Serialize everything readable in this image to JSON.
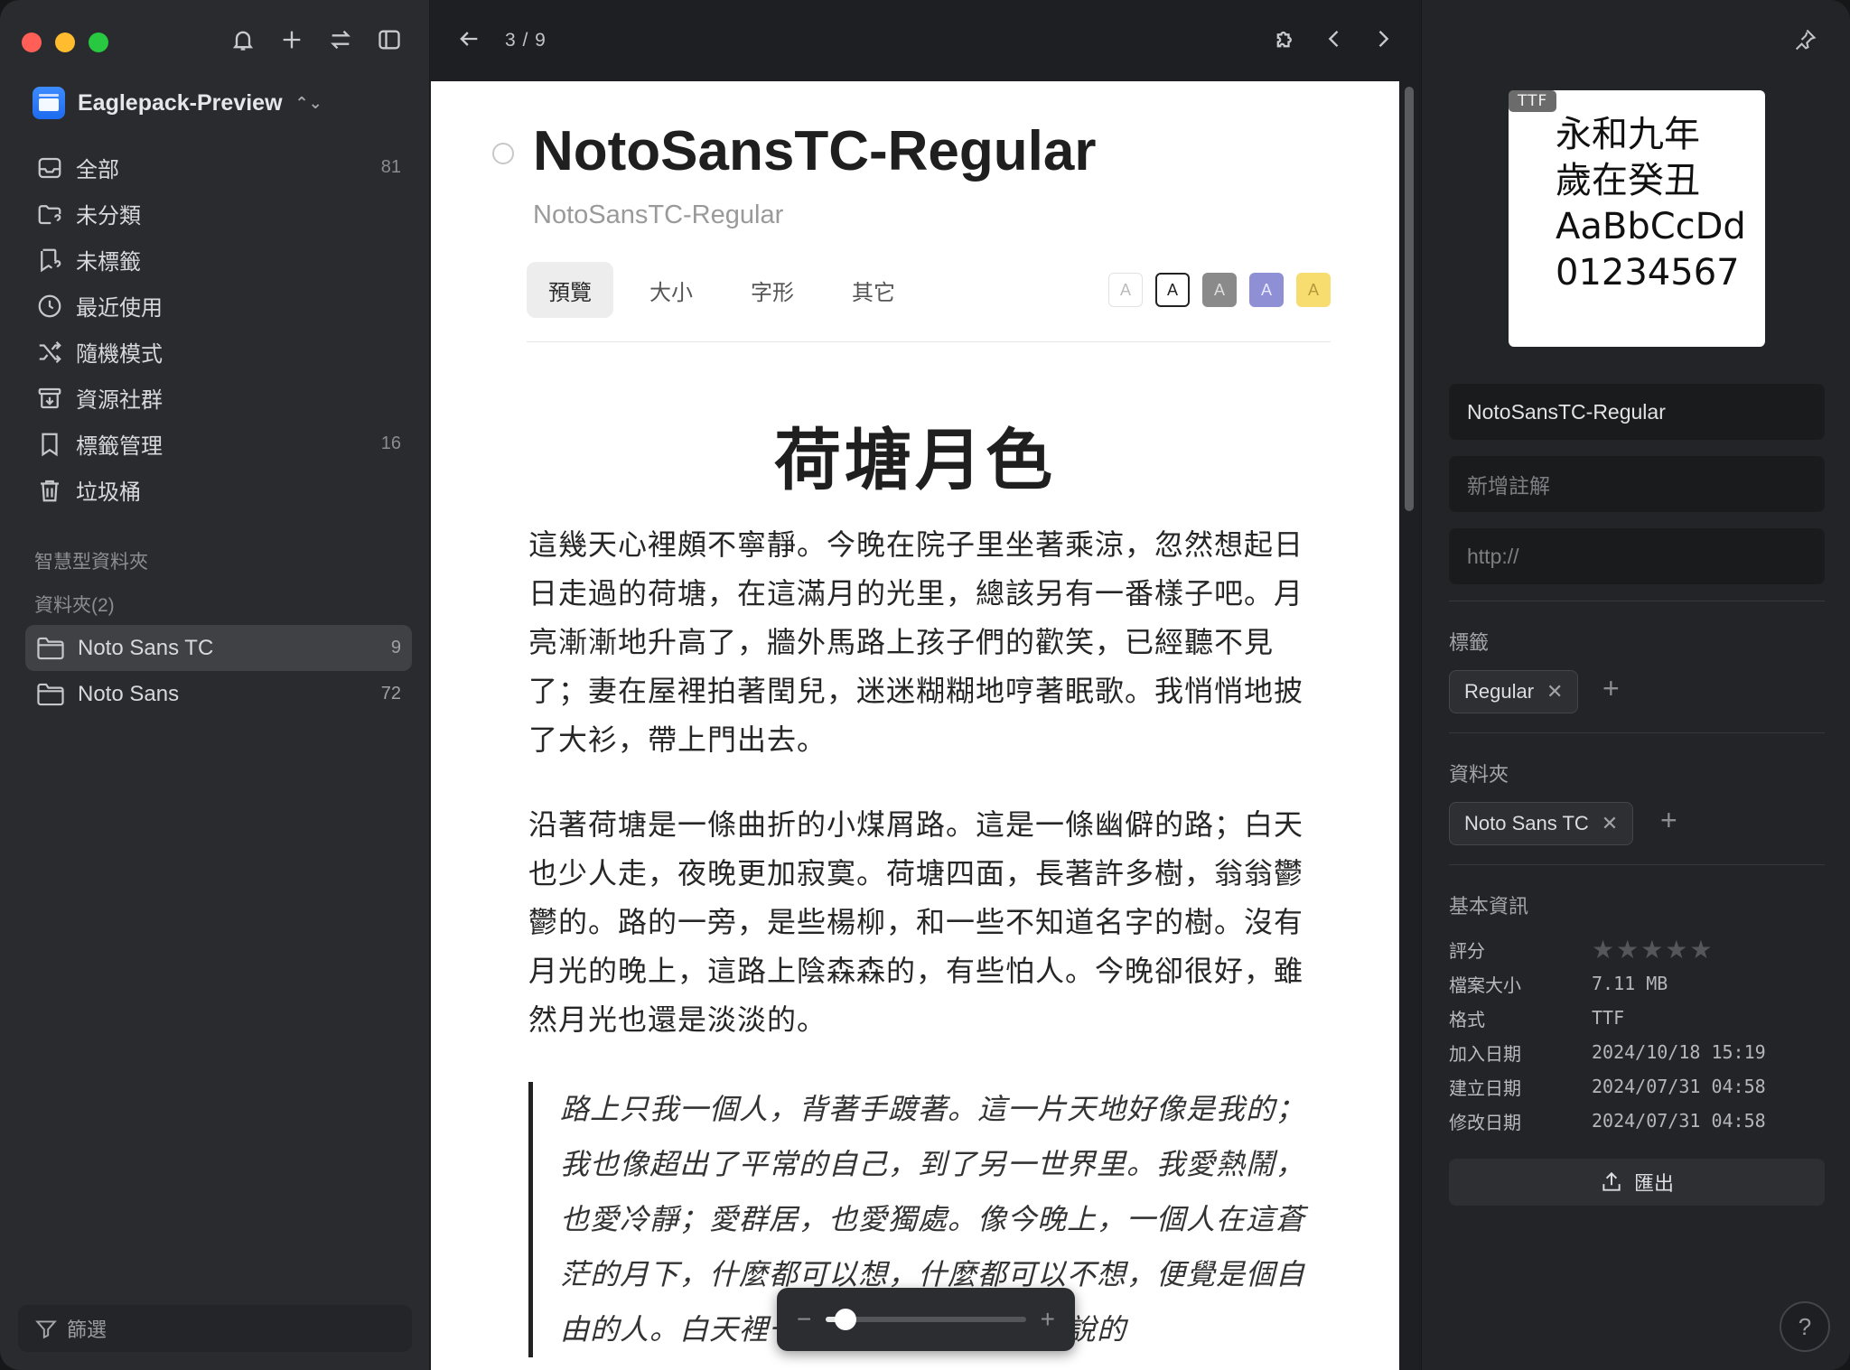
{
  "sidebar": {
    "library_name": "Eaglepack-Preview",
    "nav": [
      {
        "label": "全部",
        "count": "81",
        "icon": "inbox-icon"
      },
      {
        "label": "未分類",
        "count": "",
        "icon": "uncategorized-icon"
      },
      {
        "label": "未標籤",
        "count": "",
        "icon": "untagged-icon"
      },
      {
        "label": "最近使用",
        "count": "",
        "icon": "clock-icon"
      },
      {
        "label": "隨機模式",
        "count": "",
        "icon": "shuffle-icon"
      },
      {
        "label": "資源社群",
        "count": "",
        "icon": "community-icon"
      },
      {
        "label": "標籤管理",
        "count": "16",
        "icon": "bookmark-icon"
      },
      {
        "label": "垃圾桶",
        "count": "",
        "icon": "trash-icon"
      }
    ],
    "smart_folders_label": "智慧型資料夾",
    "folders_label": "資料夾(2)",
    "folders": [
      {
        "label": "Noto Sans TC",
        "count": "9",
        "active": true
      },
      {
        "label": "Noto Sans",
        "count": "72",
        "active": false
      }
    ],
    "filter_label": "篩選"
  },
  "toolbar": {
    "pager": "3 / 9"
  },
  "preview": {
    "font_name": "NotoSansTC-Regular",
    "font_subtitle": "NotoSansTC-Regular",
    "tabs": [
      "預覽",
      "大小",
      "字形",
      "其它"
    ],
    "active_tab": "預覽",
    "swatch_letter": "A",
    "poem_title": "荷塘月色",
    "paragraph1": "這幾天心裡頗不寧靜。今晚在院子里坐著乘涼，忽然想起日日走過的荷塘，在這滿月的光里，總該另有一番樣子吧。月亮漸漸地升高了，牆外馬路上孩子們的歡笑，已經聽不見了；妻在屋裡拍著閏兒，迷迷糊糊地哼著眠歌。我悄悄地披了大衫，帶上門出去。",
    "paragraph2": "沿著荷塘是一條曲折的小煤屑路。這是一條幽僻的路；白天也少人走，夜晚更加寂寞。荷塘四面，長著許多樹，翁翁鬱鬱的。路的一旁，是些楊柳，和一些不知道名字的樹。沒有月光的晚上，這路上陰森森的，有些怕人。今晚卻很好，雖然月光也還是淡淡的。",
    "quote": "路上只我一個人，背著手踱著。這一片天地好像是我的；我也像超出了平常的自己，到了另一世界里。我愛熱鬧，也愛冷靜；愛群居，也愛獨處。像今晚上，一個人在這蒼茫的月下，什麼都可以想，什麼都可以不想，便覺是個自由的人。白天裡一定要做的事，一定要說的",
    "zoom": {
      "level": 0.1,
      "minus": "−",
      "plus": "+"
    }
  },
  "inspector": {
    "thumb_badge": "TTF",
    "thumb_lines": [
      "永和九年",
      "歲在癸丑",
      "AaBbCcDd",
      "01234567"
    ],
    "name_value": "NotoSansTC-Regular",
    "note_placeholder": "新增註解",
    "url_placeholder": "http://",
    "tags_label": "標籤",
    "tags": [
      "Regular"
    ],
    "folders_label": "資料夾",
    "folders": [
      "Noto Sans TC"
    ],
    "basic_info_label": "基本資訊",
    "rating": {
      "label": "評分",
      "stars": "★★★★★",
      "value": 0
    },
    "info": [
      {
        "key": "檔案大小",
        "value": "7.11 MB"
      },
      {
        "key": "格式",
        "value": "TTF"
      },
      {
        "key": "加入日期",
        "value": "2024/10/18 15:19"
      },
      {
        "key": "建立日期",
        "value": "2024/07/31 04:58"
      },
      {
        "key": "修改日期",
        "value": "2024/07/31 04:58"
      }
    ],
    "export_label": "匯出",
    "help_label": "?"
  },
  "colors": {
    "accent": "#2f7bff",
    "sidebar_bg": "#2a2b2e",
    "active_folder": "#404145"
  }
}
